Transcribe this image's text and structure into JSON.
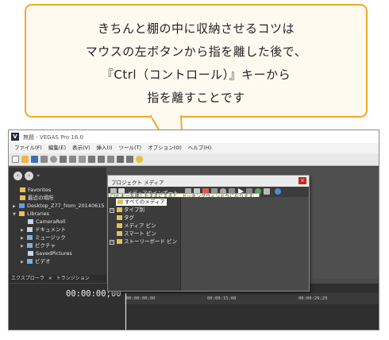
{
  "bubble": {
    "lines": [
      "きちんと棚の中に収納させるコツは",
      "マウスの左ボタンから指を離した後で、",
      "『Ctrl（コントロール）』キーから",
      "指を離すことです"
    ],
    "border_color": "#f1a829"
  },
  "app": {
    "logo": "V",
    "title": "無題 - VEGAS Pro 16.0",
    "menu": [
      "ファイル(F)",
      "編集(E)",
      "表示(V)",
      "挿入(I)",
      "ツール(T)",
      "オプション(O)",
      "ヘルプ(H)"
    ]
  },
  "explorer": {
    "nav_back": "‹",
    "nav_forward": "›",
    "nav_more": "»",
    "items": [
      {
        "label": "Favorites",
        "arrow": ""
      },
      {
        "label": "最近の場所",
        "arrow": ""
      },
      {
        "label": "Desktop_Z77_from_20140615",
        "arrow": "▶"
      },
      {
        "label": "Libraries",
        "arrow": "▼"
      },
      {
        "label": "CameraRoll",
        "arrow": ""
      },
      {
        "label": "ドキュメント",
        "arrow": "▶"
      },
      {
        "label": "ミュージック",
        "arrow": "▶"
      },
      {
        "label": "ピクチャ",
        "arrow": "▶"
      },
      {
        "label": "SavedPictures",
        "arrow": ""
      },
      {
        "label": "ビデオ",
        "arrow": "▶"
      }
    ],
    "tabs": [
      "エクスプローラ",
      "×",
      "トランジション"
    ]
  },
  "project_media": {
    "title": "プロジェクト メディア",
    "close": "×",
    "import_label": "メディアのインポート...",
    "tooltip": "Ctrl キーを押したままにすると、ドッキングウィンドウになります。",
    "tree": [
      {
        "label": "すべてのメディア",
        "selected": true,
        "expander": ""
      },
      {
        "label": "タイプ別",
        "selected": false,
        "expander": "+"
      },
      {
        "label": "タグ",
        "selected": false,
        "expander": ""
      },
      {
        "label": "メディア ビン",
        "selected": false,
        "expander": ""
      },
      {
        "label": "スマート ビン",
        "selected": false,
        "expander": ""
      },
      {
        "label": "ストーリーボード ビン",
        "selected": false,
        "expander": "+"
      }
    ]
  },
  "timeline": {
    "timecode": "00:00:00;00",
    "ruler": [
      "00:00:00;00",
      "00:00:15;00",
      "00:00:29;29"
    ]
  }
}
